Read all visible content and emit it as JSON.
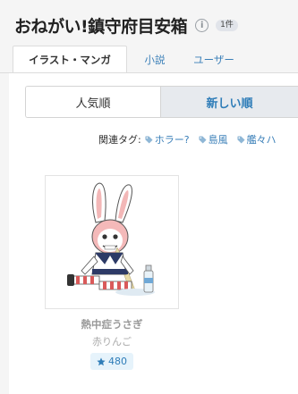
{
  "header": {
    "title": "おねがい!鎮守府目安箱",
    "info_icon": "info-icon",
    "count_badge": "1件"
  },
  "tabs": [
    {
      "label": "イラスト・マンガ",
      "active": true
    },
    {
      "label": "小説",
      "active": false
    },
    {
      "label": "ユーザー",
      "active": false
    }
  ],
  "sort": {
    "popular_label": "人気順",
    "newest_label": "新しい順",
    "selected": "newest"
  },
  "related": {
    "label": "関連タグ:",
    "tags": [
      "ホラー?",
      "島風",
      "艦々ハ"
    ],
    "tag_icon": "tag-icon"
  },
  "work": {
    "title": "熱中症うさぎ",
    "author": "赤りんご",
    "favorites": "480",
    "favorite_icon": "star-icon",
    "thumbnail": "illustration of a rabbit-masked girl in a sailor outfit kneeling beside a water bottle"
  },
  "colors": {
    "background": "#f5f5f5",
    "link": "#3a7fb8",
    "active_sort_bg": "#e7eaee",
    "favorite_bg": "#e6f3fb"
  }
}
